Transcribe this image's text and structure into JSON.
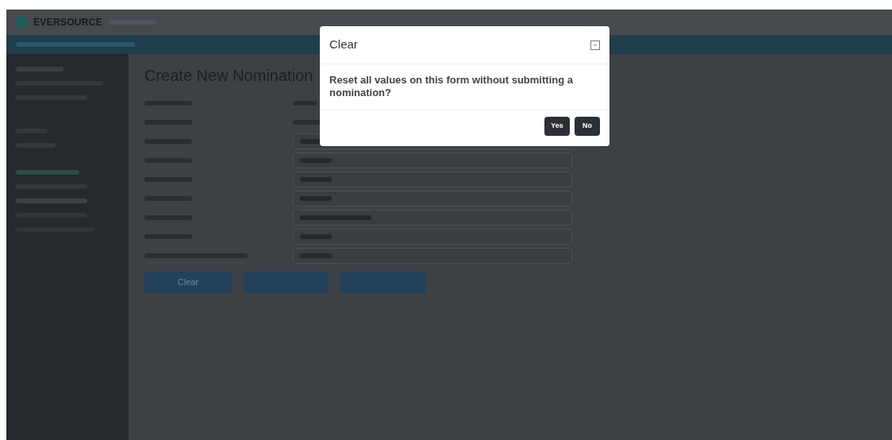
{
  "header": {
    "logo": "EVERSOURCE"
  },
  "page": {
    "title": "Create New Nomination",
    "form_buttons": [
      {
        "label": "Clear"
      }
    ]
  },
  "modal": {
    "title": "Clear",
    "message": "Reset all values on this form without submitting a nomination?",
    "buttons": [
      {
        "label": "Yes"
      },
      {
        "label": "No"
      }
    ]
  }
}
